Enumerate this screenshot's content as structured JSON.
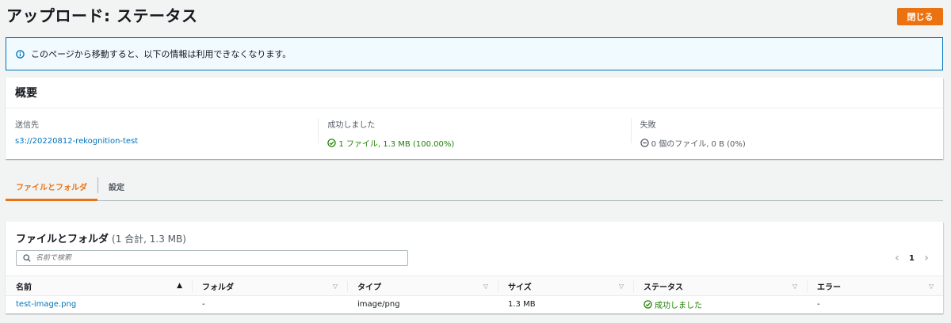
{
  "page": {
    "title": "アップロード: ステータス",
    "close_label": "閉じる"
  },
  "info": {
    "message": "このページから移動すると、以下の情報は利用できなくなります。"
  },
  "summary": {
    "title": "概要",
    "destination": {
      "label": "送信先",
      "value": "s3://20220812-rekognition-test"
    },
    "succeeded": {
      "label": "成功しました",
      "value": "1 ファイル, 1.3 MB (100.00%)"
    },
    "failed": {
      "label": "失敗",
      "value": "0 個のファイル, 0 B (0%)"
    }
  },
  "tabs": [
    {
      "label": "ファイルとフォルダ",
      "active": true
    },
    {
      "label": "設定",
      "active": false
    }
  ],
  "files": {
    "title": "ファイルとフォルダ",
    "count": "(1 合計, 1.3 MB)",
    "search_placeholder": "名前で検索",
    "page": "1",
    "columns": [
      "名前",
      "フォルダ",
      "タイプ",
      "サイズ",
      "ステータス",
      "エラー"
    ],
    "rows": [
      {
        "name": "test-image.png",
        "folder": "-",
        "type": "image/png",
        "size": "1.3 MB",
        "status": "成功しました",
        "error": "-"
      }
    ]
  },
  "colors": {
    "accent": "#ec7211",
    "link": "#0073bb",
    "success": "#1d8102",
    "info_border": "#0073bb"
  }
}
